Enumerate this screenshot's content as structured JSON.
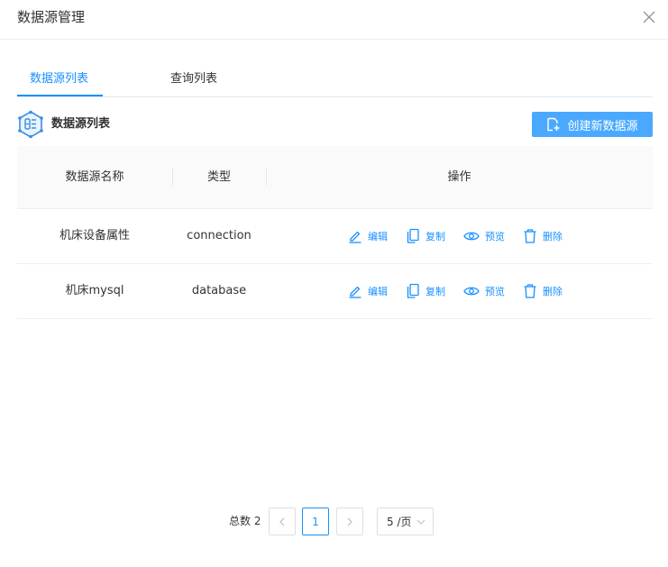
{
  "dialog": {
    "title": "数据源管理"
  },
  "tabs": [
    {
      "label": "数据源列表",
      "active": true
    },
    {
      "label": "查询列表",
      "active": false
    }
  ],
  "section": {
    "title": "数据源列表",
    "create_label": "创建新数据源"
  },
  "table": {
    "headers": [
      "数据源名称",
      "类型",
      "操作"
    ],
    "rows": [
      {
        "name": "机床设备属性",
        "type": "connection"
      },
      {
        "name": "机床mysql",
        "type": "database"
      }
    ],
    "actions": [
      "编辑",
      "复制",
      "预览",
      "删除"
    ]
  },
  "pagination": {
    "total": "总数 2",
    "current_page": "1",
    "page_size": "5 /页"
  },
  "colors": {
    "accent": "#1890ff",
    "button": "#4aa9ff",
    "header_bg": "#fafafa"
  }
}
